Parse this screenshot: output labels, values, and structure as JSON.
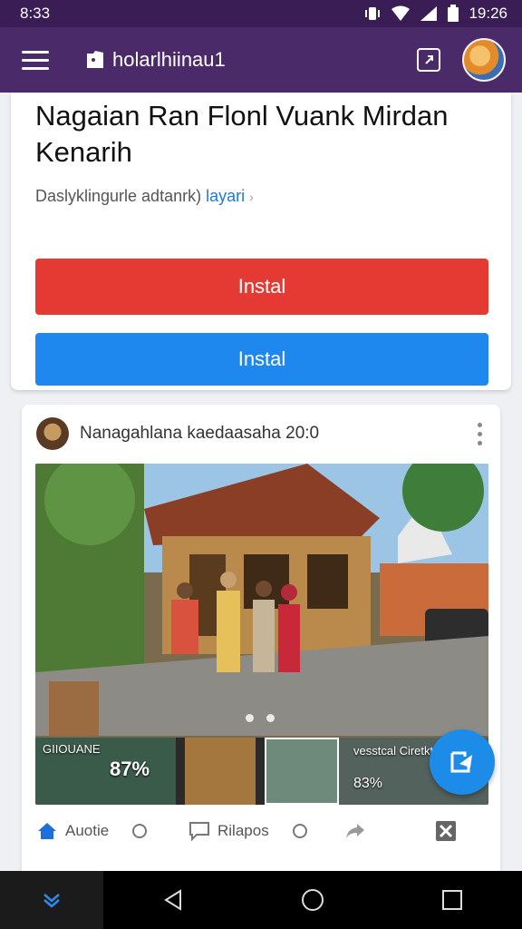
{
  "status_bar": {
    "time_left": "8:33",
    "time_right": "19:26"
  },
  "app_bar": {
    "title": "holarlhiinau1",
    "icons": [
      "menu-icon",
      "app-logo-icon",
      "external-link-icon",
      "avatar"
    ]
  },
  "promo_card": {
    "headline": "Nagaian Ran Flonl Vuank Mirdan Kenarih",
    "subline": "Daslyklingurle adtanrk)",
    "link": "layari",
    "primary_button": "Instal",
    "secondary_button": "Instal",
    "colors": {
      "primary": "#e53a33",
      "secondary": "#1e88ee"
    }
  },
  "post_card": {
    "author_title": "Nanagahlana kaedaasaha 20:0",
    "thumbnails": [
      {
        "caption": "GIIOUANE",
        "big": "87%"
      },
      {
        "caption": "",
        "big": ""
      },
      {
        "caption": "",
        "big": ""
      },
      {
        "caption": "vesstcal Ciretkton.",
        "big": "83%"
      }
    ],
    "actions": [
      {
        "icon": "home-icon",
        "label": "Auotie"
      },
      {
        "icon": "comment-icon",
        "label": "Rilapos"
      },
      {
        "icon": "share-icon",
        "label": ""
      },
      {
        "icon": "grid-icon",
        "label": ""
      }
    ]
  },
  "fab": {
    "icon": "reply-icon"
  },
  "nav_bar": {
    "icons": [
      "chevron-down-icon",
      "back-icon",
      "home-circle-icon",
      "recents-icon"
    ]
  }
}
